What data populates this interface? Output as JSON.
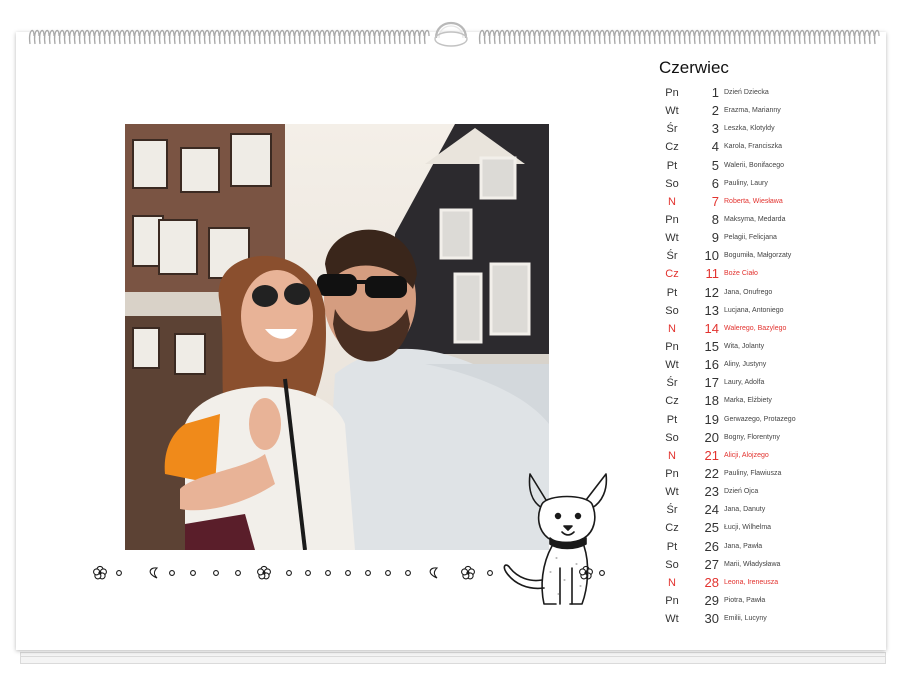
{
  "calendar": {
    "month": "Czerwiec",
    "days": [
      {
        "weekday": "Pn",
        "day": "1",
        "names": "Dzień Dziecka",
        "holiday": false
      },
      {
        "weekday": "Wt",
        "day": "2",
        "names": "Erazma, Marianny",
        "holiday": false
      },
      {
        "weekday": "Śr",
        "day": "3",
        "names": "Leszka, Klotyldy",
        "holiday": false
      },
      {
        "weekday": "Cz",
        "day": "4",
        "names": "Karola, Franciszka",
        "holiday": false
      },
      {
        "weekday": "Pt",
        "day": "5",
        "names": "Walerii, Bonifacego",
        "holiday": false
      },
      {
        "weekday": "So",
        "day": "6",
        "names": "Pauliny, Laury",
        "holiday": false
      },
      {
        "weekday": "N",
        "day": "7",
        "names": "Roberta, Wiesława",
        "holiday": true
      },
      {
        "weekday": "Pn",
        "day": "8",
        "names": "Maksyma, Medarda",
        "holiday": false
      },
      {
        "weekday": "Wt",
        "day": "9",
        "names": "Pelagii, Felicjana",
        "holiday": false
      },
      {
        "weekday": "Śr",
        "day": "10",
        "names": "Bogumiła, Małgorzaty",
        "holiday": false
      },
      {
        "weekday": "Cz",
        "day": "11",
        "names": "Boże Ciało",
        "holiday": true
      },
      {
        "weekday": "Pt",
        "day": "12",
        "names": "Jana, Onufrego",
        "holiday": false
      },
      {
        "weekday": "So",
        "day": "13",
        "names": "Lucjana, Antoniego",
        "holiday": false
      },
      {
        "weekday": "N",
        "day": "14",
        "names": "Walerego, Bazylego",
        "holiday": true
      },
      {
        "weekday": "Pn",
        "day": "15",
        "names": "Wita, Jolanty",
        "holiday": false
      },
      {
        "weekday": "Wt",
        "day": "16",
        "names": "Aliny, Justyny",
        "holiday": false
      },
      {
        "weekday": "Śr",
        "day": "17",
        "names": "Laury, Adolfa",
        "holiday": false
      },
      {
        "weekday": "Cz",
        "day": "18",
        "names": "Marka, Elżbiety",
        "holiday": false
      },
      {
        "weekday": "Pt",
        "day": "19",
        "names": "Gerwazego, Protazego",
        "holiday": false
      },
      {
        "weekday": "So",
        "day": "20",
        "names": "Bogny, Florentyny",
        "holiday": false
      },
      {
        "weekday": "N",
        "day": "21",
        "names": "Alicji, Alojzego",
        "holiday": true
      },
      {
        "weekday": "Pn",
        "day": "22",
        "names": "Pauliny, Flawiusza",
        "holiday": false
      },
      {
        "weekday": "Wt",
        "day": "23",
        "names": "Dzień Ojca",
        "holiday": false
      },
      {
        "weekday": "Śr",
        "day": "24",
        "names": "Jana, Danuty",
        "holiday": false
      },
      {
        "weekday": "Cz",
        "day": "25",
        "names": "Łucji, Wilhelma",
        "holiday": false
      },
      {
        "weekday": "Pt",
        "day": "26",
        "names": "Jana, Pawła",
        "holiday": false
      },
      {
        "weekday": "So",
        "day": "27",
        "names": "Marii, Władysława",
        "holiday": false
      },
      {
        "weekday": "N",
        "day": "28",
        "names": "Leona, Ireneusza",
        "holiday": true
      },
      {
        "weekday": "Pn",
        "day": "29",
        "names": "Piotra, Pawła",
        "holiday": false
      },
      {
        "weekday": "Wt",
        "day": "30",
        "names": "Emilii, Lucyny",
        "holiday": false
      }
    ]
  },
  "colors": {
    "holiday": "#e2332f",
    "text": "#333333",
    "page": "#ffffff",
    "spiral": "#b5b5b5"
  },
  "icons": {
    "binding": "spiral-binding-icon",
    "hanger": "hanger-hook-icon",
    "decoration": "flower-heart-dot-border",
    "illustration": "chihuahua-dog-drawing"
  }
}
